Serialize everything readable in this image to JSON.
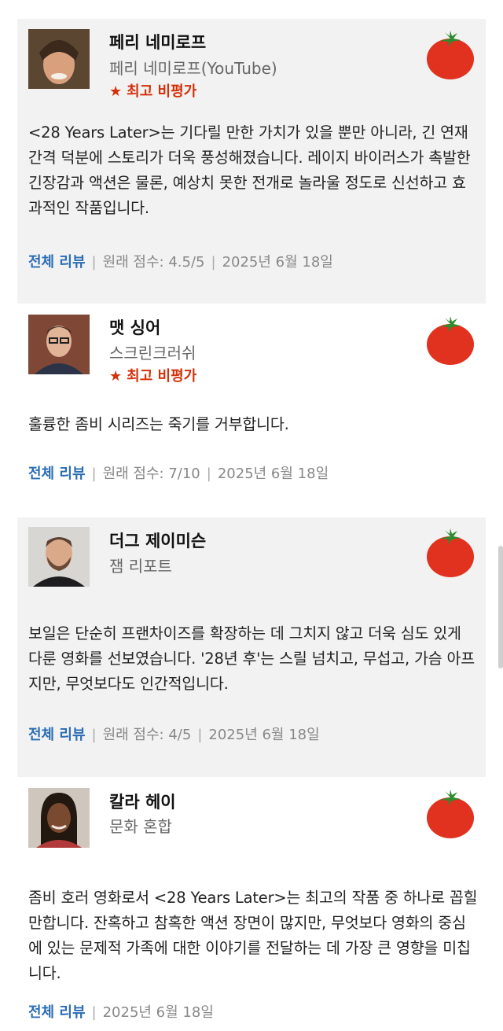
{
  "reviews": [
    {
      "name": "페리 네미로프",
      "outlet": "페리 네미로프(YouTube)",
      "badge": "최고 비평가",
      "quote": "<28 Years Later>는 기다릴 만한 가치가 있을 뿐만 아니라, 긴 연재 간격 덕분에 스토리가 더욱 풍성해졌습니다. 레이지 바이러스가 촉발한 긴장감과 액션은 물론, 예상치 못한 전개로 놀라울 정도로 신선하고 효과적인 작품입니다.",
      "full_review": "전체 리뷰",
      "score": "원래 점수: 4.5/5",
      "date": "2025년 6월 18일"
    },
    {
      "name": "맷 싱어",
      "outlet": "스크린크러쉬",
      "badge": "최고 비평가",
      "quote": "훌륭한 좀비 시리즈는 죽기를 거부합니다.",
      "full_review": "전체 리뷰",
      "score": "원래 점수: 7/10",
      "date": "2025년 6월 18일"
    },
    {
      "name": "더그 제이미슨",
      "outlet": "잼 리포트",
      "quote": "보일은 단순히 프랜차이즈를 확장하는 데 그치지 않고 더욱 심도 있게 다룬 영화를 선보였습니다. '28년 후'는 스릴 넘치고, 무섭고, 가슴 아프지만, 무엇보다도 인간적입니다.",
      "full_review": "전체 리뷰",
      "score": "원래 점수: 4/5",
      "date": "2025년 6월 18일"
    },
    {
      "name": "칼라 헤이",
      "outlet": "문화 혼합",
      "quote": "좀비 호러 영화로서 <28 Years Later>는 최고의 작품 중 하나로 꼽힐 만합니다. 잔혹하고 참혹한 액션 장면이 많지만, 무엇보다 영화의 중심에 있는 문제적 가족에 대한 이야기를 전달하는 데 가장 큰 영향을 미칩니다.",
      "full_review": "전체 리뷰",
      "date": "2025년 6월 18일"
    }
  ],
  "icons": {
    "rating": "fresh-tomato-icon",
    "badge": "star-icon"
  },
  "colors": {
    "card_bg": "#f2f2f2",
    "link": "#2a6db3",
    "badge": "#d4300a",
    "tomato": "#e0321f"
  }
}
